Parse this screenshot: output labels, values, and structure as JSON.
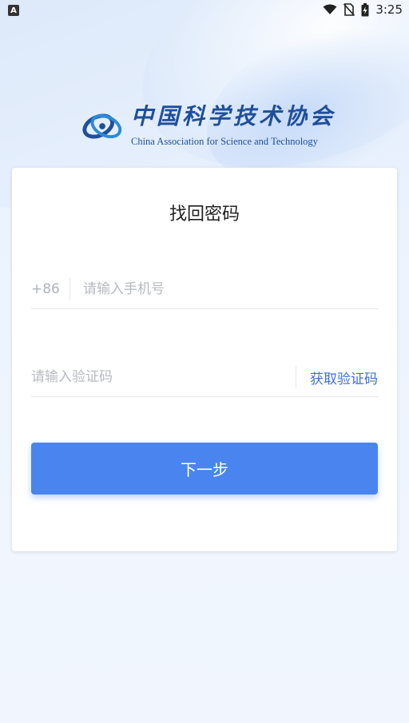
{
  "status_bar": {
    "app_icon_label": "A",
    "time": "3:25"
  },
  "logo": {
    "chinese_name": "中国科学技术协会",
    "english_name": "China Association for Science and Technology",
    "brand_color": "#1f4f9a"
  },
  "form": {
    "title": "找回密码",
    "country_code": "+86",
    "phone_placeholder": "请输入手机号",
    "code_placeholder": "请输入验证码",
    "get_code_label": "获取验证码",
    "next_label": "下一步"
  },
  "colors": {
    "primary_button": "#4a84ee",
    "link": "#3f6fd6"
  },
  "icons": [
    "wifi-icon",
    "no-sim-icon",
    "battery-charging-icon"
  ]
}
